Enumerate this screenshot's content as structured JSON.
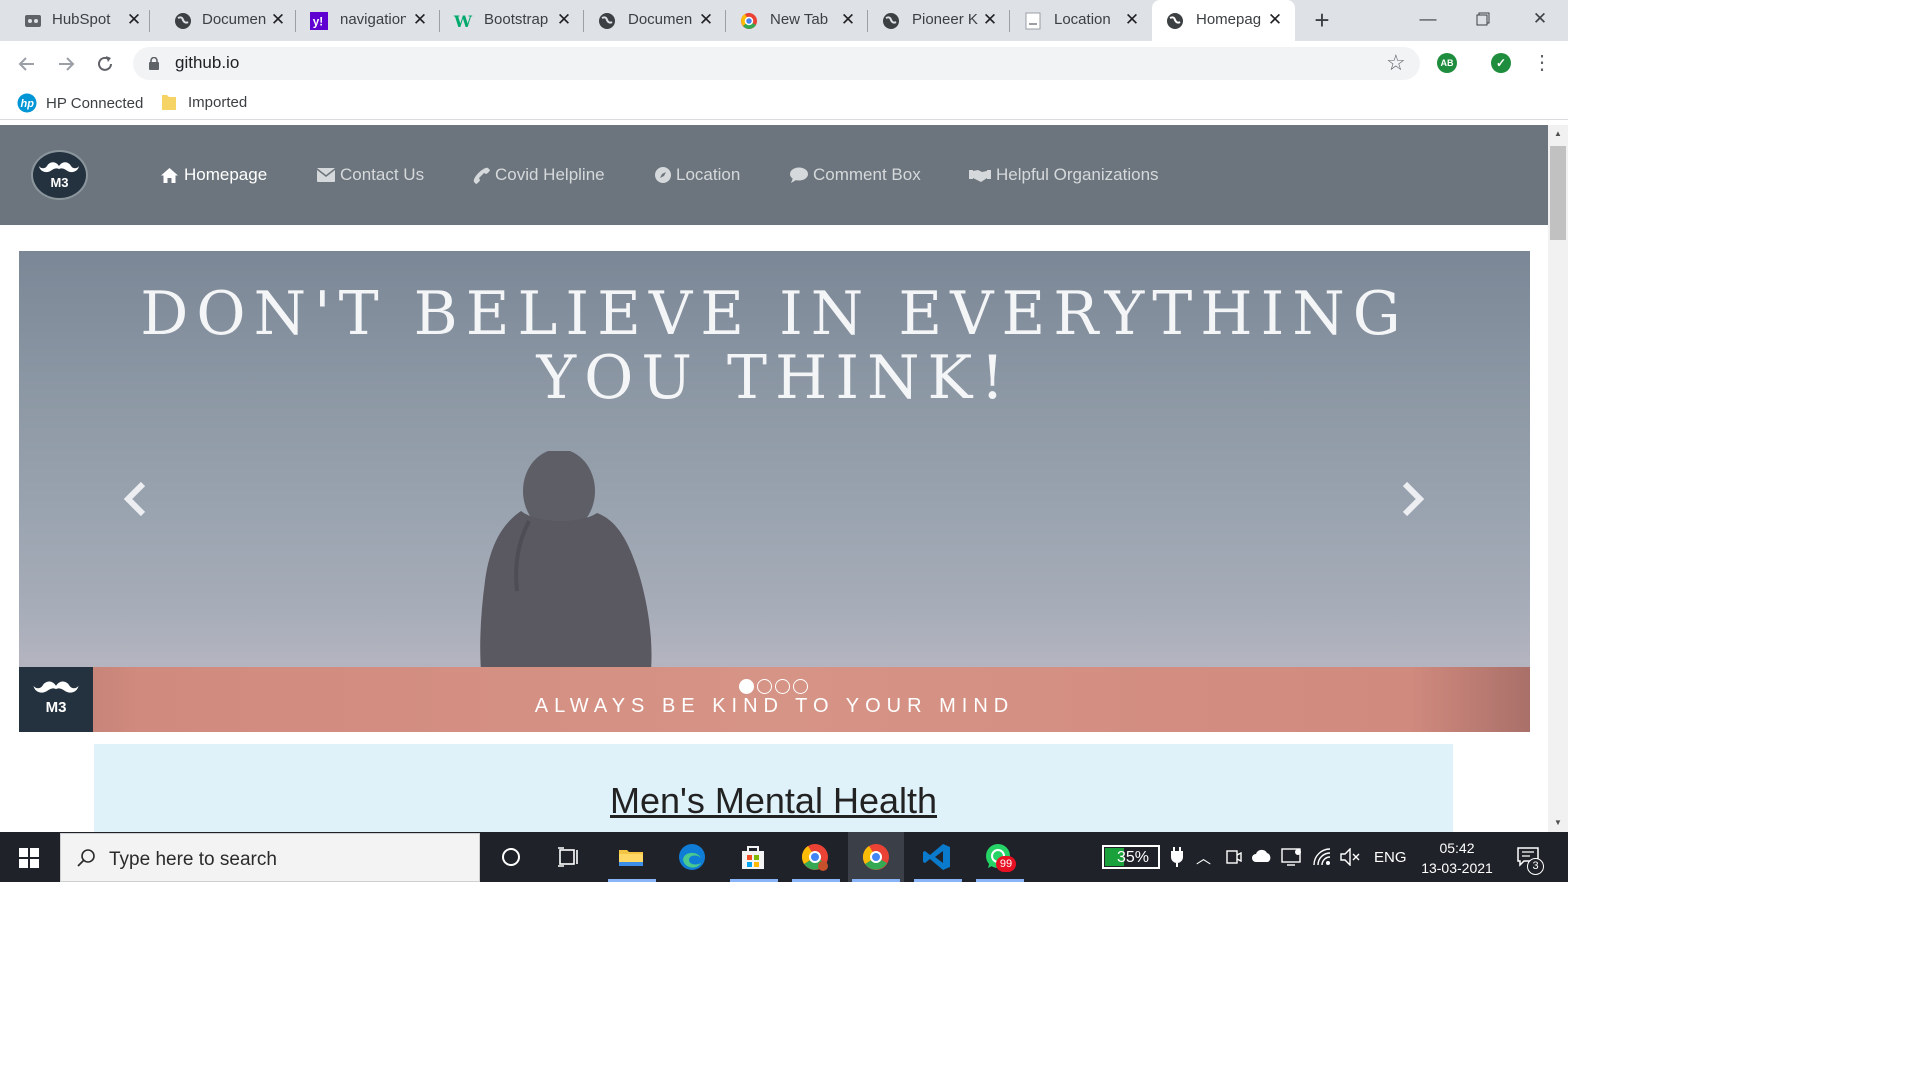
{
  "browser": {
    "tabs": [
      {
        "title": "HubSpot",
        "icon": "hubspot-icon"
      },
      {
        "title": "Documen",
        "icon": "globe-icon"
      },
      {
        "title": "navigation",
        "icon": "yahoo-icon"
      },
      {
        "title": "Bootstrap",
        "icon": "w3schools-icon"
      },
      {
        "title": "Documen",
        "icon": "globe-icon"
      },
      {
        "title": "New Tab",
        "icon": "chrome-icon"
      },
      {
        "title": "Pioneer K",
        "icon": "globe-icon"
      },
      {
        "title": "Location",
        "icon": "page-icon"
      },
      {
        "title": "Homepag",
        "icon": "globe-icon",
        "active": true
      }
    ],
    "url": "github.io",
    "bookmarks": [
      {
        "label": "HP Connected",
        "icon": "hp-icon"
      },
      {
        "label": "Imported",
        "icon": "folder-icon"
      }
    ],
    "extensions": [
      {
        "label": "AB",
        "color": "#1e8e3e"
      }
    ]
  },
  "site": {
    "logo_text": "M3",
    "nav": [
      {
        "label": "Homepage",
        "icon": "home-icon",
        "active": true
      },
      {
        "label": "Contact Us",
        "icon": "envelope-icon"
      },
      {
        "label": "Covid Helpline",
        "icon": "phone-icon"
      },
      {
        "label": "Location",
        "icon": "compass-icon"
      },
      {
        "label": "Comment Box",
        "icon": "comment-icon"
      },
      {
        "label": "Helpful Organizations",
        "icon": "handshake-icon"
      }
    ],
    "carousel": {
      "quote_line1": "DON'T BELIEVE IN EVERYTHING",
      "quote_line2": "YOU THINK!",
      "tagline": "ALWAYS BE KIND TO YOUR MIND",
      "banner_logo_text": "M3",
      "slide_count": 4,
      "active_slide": 1
    },
    "section_title": "Men's Mental Health"
  },
  "taskbar": {
    "search_placeholder": "Type here to search",
    "battery_percent": "35%",
    "battery_level": 0.35,
    "language": "ENG",
    "time": "05:42",
    "date": "13-03-2021",
    "whatsapp_badge": "99",
    "notification_count": "3"
  },
  "colors": {
    "navbar": "#6c757d",
    "banner": "#d69486",
    "section_bg": "#dff2fa",
    "taskbar": "#1f2329"
  }
}
